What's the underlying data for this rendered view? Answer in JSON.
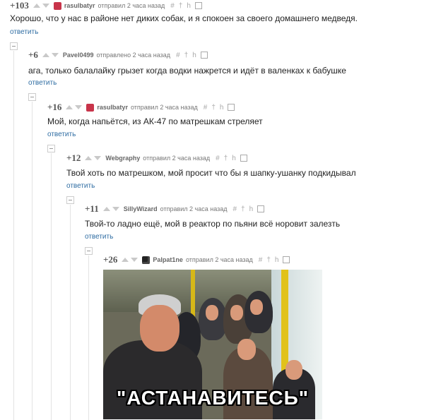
{
  "comments": [
    {
      "rating": "+103",
      "author": "rasulbatyr",
      "posted": "отправил 2 часа назад",
      "text": "Хорошо, что у нас в районе нет диких собак, и я спокоен за своего домашнего медведя.",
      "reply": "ответить"
    },
    {
      "rating": "+6",
      "author": "Pavel0499",
      "posted": "отправлено 2 часа назад",
      "text": "ага, только балалайку грызет когда водки нажрется и идёт в валенках к бабушке",
      "reply": "ответить"
    },
    {
      "rating": "+16",
      "author": "rasulbatyr",
      "posted": "отправил 2 часа назад",
      "text": "Мой, когда напьётся, из АК-47 по матрешкам стреляет",
      "reply": "ответить"
    },
    {
      "rating": "+12",
      "author": "Webgraphy",
      "posted": "отправил 2 часа назад",
      "text": "Твой хоть по матрешком, мой просит что бы я шапку-ушанку подкидывал",
      "reply": "ответить"
    },
    {
      "rating": "+11",
      "author": "SillyWizard",
      "posted": "отправил 2 часа назад",
      "text": "Твой-то ладно ещё, мой в реактор по пьяни всё норовит залезть",
      "reply": "ответить"
    },
    {
      "rating": "+26",
      "author": "Palpat1ne",
      "posted": "отправил 2 часа назад",
      "image_caption": "\"АСТАНАВИТЕСЬ\""
    }
  ],
  "tools": {
    "hash": "#",
    "plus": "†",
    "link": "h"
  },
  "colors": {
    "reply_link": "#2f6da3",
    "avatar_red": "#c8344a",
    "arrow": "#c9c9c9"
  }
}
